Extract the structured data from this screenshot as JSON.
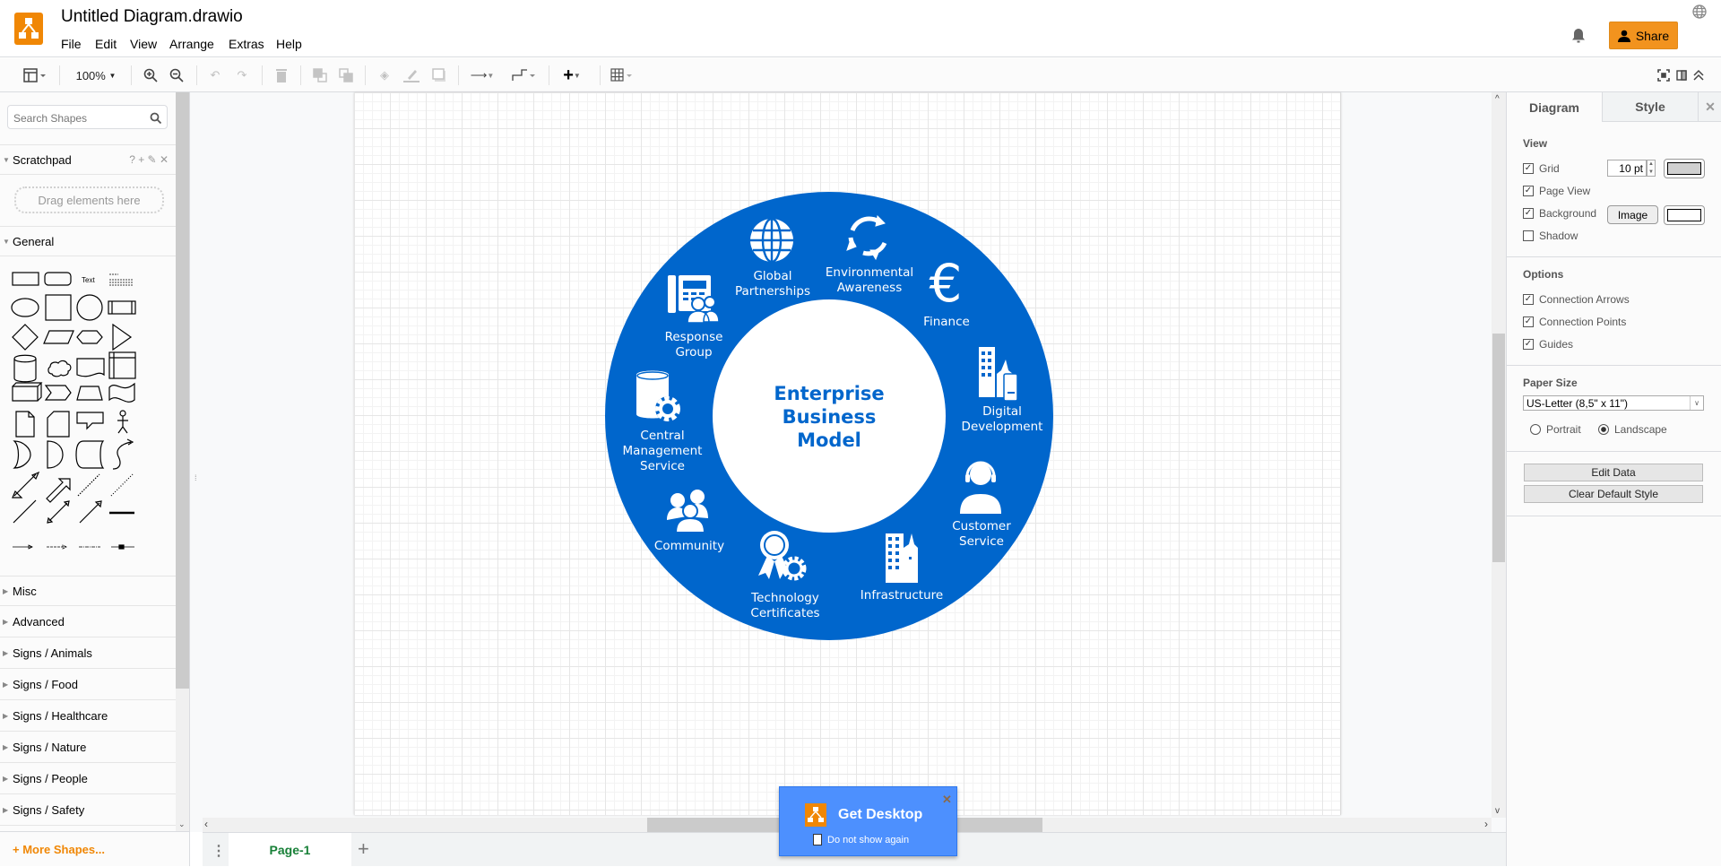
{
  "header": {
    "title": "Untitled Diagram.drawio",
    "menu": [
      "File",
      "Edit",
      "View",
      "Arrange",
      "Extras",
      "Help"
    ],
    "share_label": "Share",
    "accent": "#f08705"
  },
  "toolbar": {
    "zoom": "100%"
  },
  "sidebar": {
    "search_placeholder": "Search Shapes",
    "scratchpad": "Scratchpad",
    "scratchpad_tools": "? + ✎ ✕",
    "drag_hint": "Drag elements here",
    "general": "General",
    "text_shape": "Text",
    "sections": [
      "Misc",
      "Advanced",
      "Signs / Animals",
      "Signs / Food",
      "Signs / Healthcare",
      "Signs / Nature",
      "Signs / People",
      "Signs / Safety"
    ],
    "more_shapes": "More Shapes..."
  },
  "diagram": {
    "center": [
      "Enterprise",
      "Business",
      "Model"
    ],
    "ring_color": "#0066cc",
    "items": [
      {
        "label": [
          "Global",
          "Partnerships"
        ],
        "icon": "globe"
      },
      {
        "label": [
          "Environmental",
          "Awareness"
        ],
        "icon": "recycle"
      },
      {
        "label": [
          "Finance"
        ],
        "icon": "euro"
      },
      {
        "label": [
          "Digital",
          "Development"
        ],
        "icon": "buildings-device"
      },
      {
        "label": [
          "Customer",
          "Service"
        ],
        "icon": "headset-person"
      },
      {
        "label": [
          "Infrastructure"
        ],
        "icon": "buildings"
      },
      {
        "label": [
          "Technology",
          "Certificates"
        ],
        "icon": "award-gear"
      },
      {
        "label": [
          "Community"
        ],
        "icon": "people"
      },
      {
        "label": [
          "Central",
          "Management",
          "Service"
        ],
        "icon": "database-gear"
      },
      {
        "label": [
          "Response",
          "Group"
        ],
        "icon": "phone-people"
      }
    ]
  },
  "pages": {
    "current": "Page-1"
  },
  "popup": {
    "title": "Get Desktop",
    "checkbox": "Do not show again"
  },
  "format": {
    "tabs": [
      "Diagram",
      "Style"
    ],
    "view": "View",
    "grid": "Grid",
    "grid_size": "10 pt",
    "page_view": "Page View",
    "background": "Background",
    "image_btn": "Image",
    "shadow": "Shadow",
    "options": "Options",
    "conn_arrows": "Connection Arrows",
    "conn_points": "Connection Points",
    "guides": "Guides",
    "paper_size": "Paper Size",
    "paper_value": "US-Letter (8,5\" x 11\")",
    "portrait": "Portrait",
    "landscape": "Landscape",
    "edit_data": "Edit Data",
    "clear_style": "Clear Default Style",
    "checked": {
      "grid": true,
      "page_view": true,
      "background": true,
      "shadow": false,
      "conn_arrows": true,
      "conn_points": true,
      "guides": true
    },
    "orientation": "Landscape"
  }
}
